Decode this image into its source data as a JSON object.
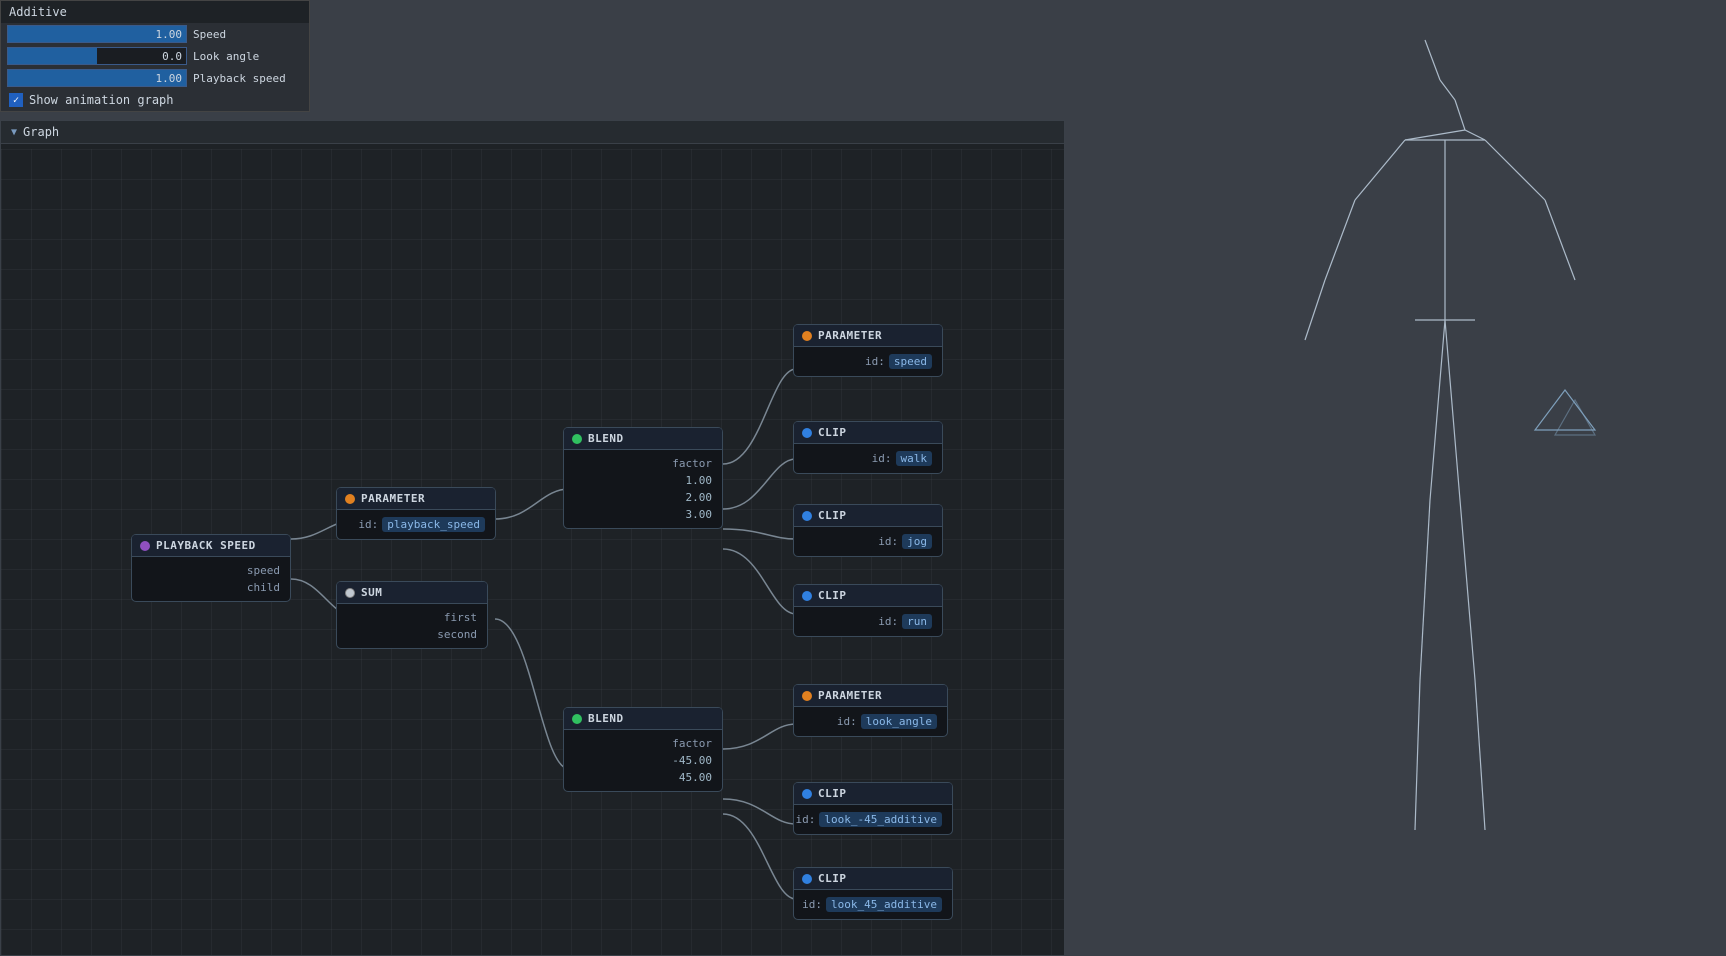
{
  "topPanel": {
    "title": "Additive",
    "params": [
      {
        "label": "Speed",
        "value": "1.00",
        "fillPct": 100
      },
      {
        "label": "Look angle",
        "value": "0.0",
        "fillPct": 50
      },
      {
        "label": "Playback speed",
        "value": "1.00",
        "fillPct": 100
      }
    ],
    "showAnimGraph": "Show animation graph"
  },
  "graph": {
    "title": "Graph"
  },
  "nodes": {
    "playbackSpeed": {
      "header": "PLAYBACK SPEED",
      "dotColor": "purple",
      "outputs": [
        "speed",
        "child"
      ]
    },
    "parameter1": {
      "header": "PARAMETER",
      "dotColor": "orange",
      "field": {
        "label": "id:",
        "value": "playback_speed"
      }
    },
    "sum": {
      "header": "SUM",
      "dotColor": "white",
      "inputs": [
        "first",
        "second"
      ]
    },
    "blend1": {
      "header": "BLEND",
      "dotColor": "green",
      "inputs": [
        "factor"
      ],
      "values": [
        "1.00",
        "2.00",
        "3.00"
      ]
    },
    "parameter2": {
      "header": "PARAMETER",
      "dotColor": "orange",
      "field": {
        "label": "id:",
        "value": "speed"
      }
    },
    "clipWalk": {
      "header": "CLIP",
      "dotColor": "blue",
      "field": {
        "label": "id:",
        "value": "walk"
      }
    },
    "clipJog": {
      "header": "CLIP",
      "dotColor": "blue",
      "field": {
        "label": "id:",
        "value": "jog"
      }
    },
    "clipRun": {
      "header": "CLIP",
      "dotColor": "blue",
      "field": {
        "label": "id:",
        "value": "run"
      }
    },
    "blend2": {
      "header": "BLEND",
      "dotColor": "green",
      "inputs": [
        "factor"
      ],
      "values": [
        "-45.00",
        "45.00"
      ]
    },
    "parameter3": {
      "header": "PARAMETER",
      "dotColor": "orange",
      "field": {
        "label": "id:",
        "value": "look_angle"
      }
    },
    "clipLookNeg45": {
      "header": "CLIP",
      "dotColor": "blue",
      "field": {
        "label": "id:",
        "value": "look_-45_additive"
      }
    },
    "clipLookPos45": {
      "header": "CLIP",
      "dotColor": "blue",
      "field": {
        "label": "id:",
        "value": "look_45_additive"
      }
    }
  }
}
